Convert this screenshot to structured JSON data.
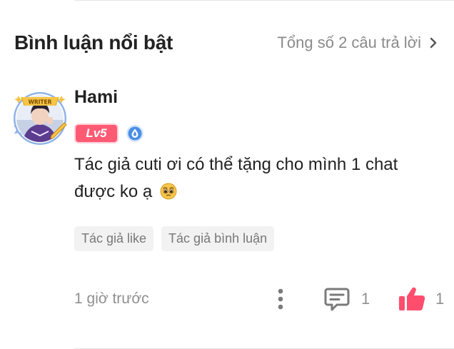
{
  "section": {
    "title": "Bình luận nổi bật",
    "total_link": "Tổng số 2 câu trả lời"
  },
  "comment": {
    "username": "Hami",
    "level": "Lv5",
    "avatar_badge_text": "WRITER",
    "text": "Tác giả cuti ơi có thể tặng cho mình 1 chat được ko ạ",
    "emoji": "pleading-face",
    "tags": [
      "Tác giả like",
      "Tác giả bình luận"
    ],
    "time": "1 giờ trước",
    "reply_count": "1",
    "like_count": "1"
  },
  "colors": {
    "level_badge": "#ff5a74",
    "like_icon": "#ff4d6d",
    "drop_badge": "#4a8fe6",
    "muted_text": "#8f8f8f",
    "icon_gray": "#7a7a7a"
  }
}
